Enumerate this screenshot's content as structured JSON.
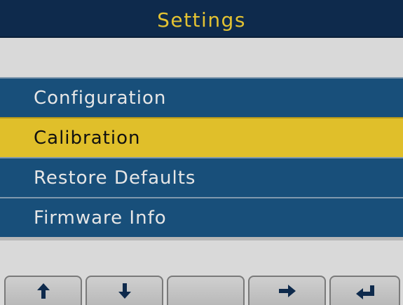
{
  "header": {
    "title": "Settings"
  },
  "menu": {
    "items": [
      {
        "label": "Configuration",
        "selected": false
      },
      {
        "label": "Calibration",
        "selected": true
      },
      {
        "label": "Restore Defaults",
        "selected": false
      },
      {
        "label": "Firmware Info",
        "selected": false
      }
    ]
  },
  "softkeys": {
    "keys": [
      {
        "icon": "arrow-up-icon"
      },
      {
        "icon": "arrow-down-icon"
      },
      {
        "icon": ""
      },
      {
        "icon": "arrow-right-icon"
      },
      {
        "icon": "enter-return-icon"
      }
    ]
  },
  "colors": {
    "title_bar": "#0e2a4c",
    "title_text": "#e3c232",
    "menu_item": "#184f7a",
    "menu_selected": "#e0bf2a",
    "background": "#d9d9d9"
  }
}
